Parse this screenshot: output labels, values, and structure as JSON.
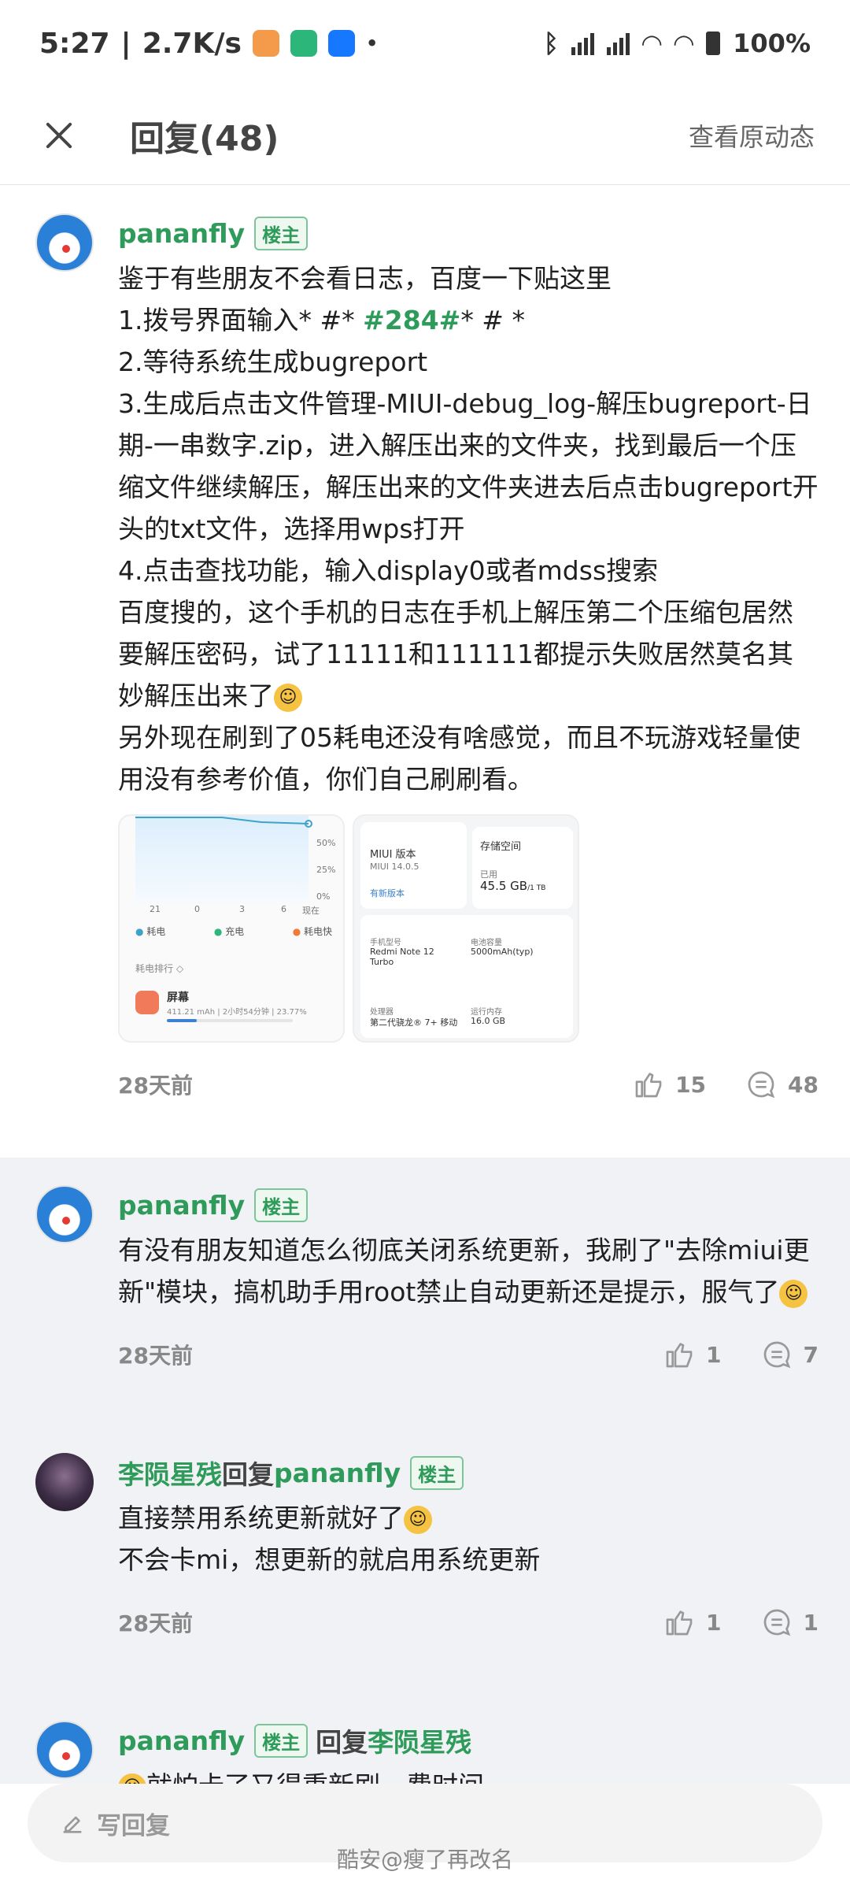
{
  "status_bar": {
    "time": "5:27",
    "speed": "2.7K/s",
    "battery": "100%"
  },
  "header": {
    "title": "回复(48)",
    "action": "查看原动态"
  },
  "posts": [
    {
      "name": "pananfly",
      "badge": "楼主",
      "lines": [
        "鉴于有些朋友不会看日志，百度一下贴这里",
        "1.拨号界面输入* #* ",
        "#284#",
        "* # *",
        "2.等待系统生成bugreport",
        "3.生成后点击文件管理-MIUI-debug_log-解压bugreport-日期-一串数字.zip，进入解压出来的文件夹，找到最后一个压缩文件继续解压，解压出来的文件夹进去后点击bugreport开头的txt文件，选择用wps打开",
        "4.点击查找功能，输入display0或者mdss搜索",
        "百度搜的，这个手机的日志在手机上解压第二个压缩包居然要解压密码，试了11111和111111都提示失败居然莫名其妙解压出来了",
        "另外现在刷到了05耗电还没有啥感觉，而且不玩游戏轻量使用没有参考价值，你们自己刷刷看。"
      ],
      "image1": {
        "pct_50": "50%",
        "pct_25": "25%",
        "pct_0": "0%",
        "ticks": [
          "21",
          "0",
          "3",
          "6",
          "现在"
        ],
        "legend": [
          "耗电",
          "充电",
          "耗电快"
        ],
        "rank": "耗电排行 ◇",
        "item": "屏幕",
        "item_sub": "411.21 mAh | 2小时54分钟 | 23.77%"
      },
      "image2": {
        "miui_label": "MIUI 版本",
        "miui_value": "MIUI 14.0.5",
        "new_version": "有新版本",
        "storage_label": "存储空间",
        "storage_used_label": "已用",
        "storage_value": "45.5 GB",
        "storage_total": "/1 TB",
        "model_label": "手机型号",
        "model_value": "Redmi Note 12 Turbo",
        "battery_label": "电池容量",
        "battery_value": "5000mAh(typ)",
        "cpu_label": "处理器",
        "cpu_value": "第二代骁龙® 7+ 移动",
        "ram_label": "运行内存",
        "ram_value": "16.0 GB"
      },
      "time": "28天前",
      "likes": "15",
      "comments": "48"
    },
    {
      "name": "pananfly",
      "badge": "楼主",
      "text": "有没有朋友知道怎么彻底关闭系统更新，我刷了\"去除miui更新\"模块，搞机助手用root禁止自动更新还是提示，服气了",
      "time": "28天前",
      "likes": "1",
      "comments": "7"
    },
    {
      "name": "李陨星残",
      "reply_word": "回复",
      "reply_to": "pananfly",
      "badge": "楼主",
      "lines": [
        "直接禁用系统更新就好了",
        "不会卡mi，想更新的就启用系统更新"
      ],
      "time": "28天前",
      "likes": "1",
      "comments": "1"
    },
    {
      "name": "pananfly",
      "badge": "楼主",
      "reply_word": "回复",
      "reply_to": "李陨星残",
      "text": "就怕卡了又得重新刷，费时间"
    }
  ],
  "bottom": {
    "placeholder": "写回复",
    "watermark": "酷安@瘦了再改名"
  },
  "colors": {
    "accent_green": "#2f9b5b",
    "gray_bg": "#f1f2f5"
  }
}
